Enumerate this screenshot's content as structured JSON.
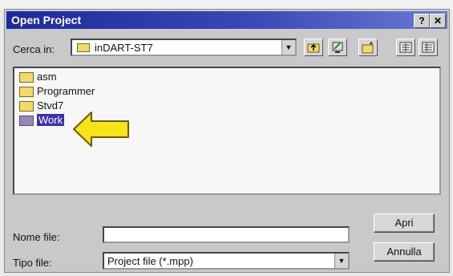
{
  "window": {
    "title": "Open Project",
    "help_label": "?",
    "close_label": "✕"
  },
  "look_in": {
    "label": "Cerca in:",
    "value": "inDART-ST7"
  },
  "toolbar": {
    "icons": [
      "up-folder-icon",
      "desktop-icon",
      "new-folder-icon",
      "list-view-icon",
      "details-view-icon"
    ]
  },
  "folders": [
    {
      "name": "asm",
      "selected": false
    },
    {
      "name": "Programmer",
      "selected": false
    },
    {
      "name": "Stvd7",
      "selected": false
    },
    {
      "name": "Work",
      "selected": true
    }
  ],
  "file_name": {
    "label": "Nome file:",
    "value": ""
  },
  "file_type": {
    "label": "Tipo file:",
    "value": "Project file (*.mpp)"
  },
  "buttons": {
    "open": "Apri",
    "cancel": "Annulla"
  },
  "colors": {
    "titlebar": "#1d2a9a",
    "selection": "#3d2fa8",
    "pointer_arrow": "#f6e31a"
  }
}
